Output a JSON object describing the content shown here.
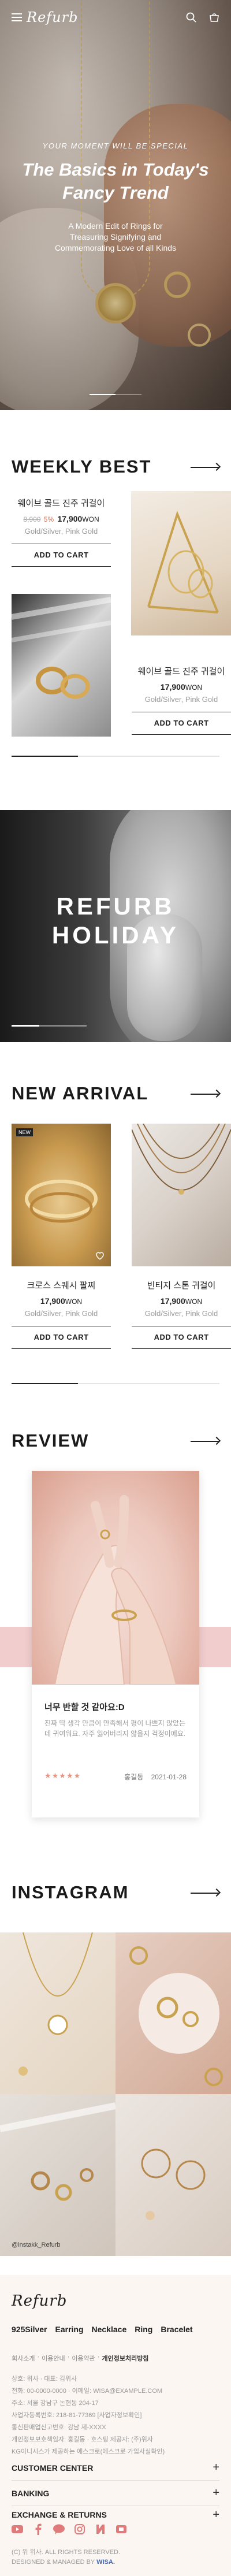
{
  "header": {
    "logo": "Refurb"
  },
  "hero": {
    "kicker": "YOUR MOMENT WILL BE SPECIAL",
    "title_line1": "The Basics in Today's",
    "title_line2": "Fancy Trend",
    "sub_line1": "A Modern Edit of Rings for",
    "sub_line2": "Treasuring Signifying and",
    "sub_line3": "Commemorating Love of all Kinds"
  },
  "weekly_best": {
    "title": "WEEKLY BEST",
    "products": [
      {
        "name": "웨이브 골드 진주 귀걸이",
        "old_price": "8,900",
        "discount": "5%",
        "price": "17,900",
        "unit": "WON",
        "colors": "Gold/Silver, Pink Gold",
        "cart": "ADD TO CART"
      },
      {
        "name": "웨이브 골드 진주 귀걸이",
        "price": "17,900",
        "unit": "WON",
        "colors": "Gold/Silver, Pink Gold",
        "cart": "ADD TO CART"
      }
    ]
  },
  "holiday": {
    "line1": "REFURB",
    "line2": "HOLIDAY"
  },
  "new_arrival": {
    "title": "NEW ARRIVAL",
    "products": [
      {
        "badge": "NEW",
        "name": "크로스 스퀘시 팔찌",
        "price": "17,900",
        "unit": "WON",
        "colors": "Gold/Silver, Pink Gold",
        "cart": "ADD TO CART"
      },
      {
        "name": "빈티지 스톤 귀걸이",
        "price": "17,900",
        "unit": "WON",
        "colors": "Gold/Silver, Pink Gold",
        "cart": "ADD TO CART"
      }
    ]
  },
  "review": {
    "title": "REVIEW",
    "card": {
      "headline": "너무 반할 것 같아요:D",
      "body": "진짜 딱 생각 만큼이 만족해서 평이 나쁘지 않았는데 귀여워요. 자주 잃어버리지 않을지 걱정이에요.",
      "stars": "★★★★★",
      "author": "홍길동",
      "date": "2021-01-28"
    }
  },
  "instagram": {
    "title": "INSTAGRAM",
    "handle": "@instakk_Refurb"
  },
  "footer": {
    "logo": "Refurb",
    "categories": [
      "925Silver",
      "Earring",
      "Necklace",
      "Ring",
      "Bracelet"
    ],
    "links": [
      "회사소개",
      "이용안내",
      "이용약관",
      "개인정보처리방침"
    ],
    "info": [
      "상호: 위사 · 대표: 김위사",
      "전화: 00-0000-0000 · 이메일: WISA@EXAMPLE.COM",
      "주소: 서울 강남구 논현동 204-17",
      "사업자등록번호: 218-81-77369 [사업자정보확인]",
      "통신판매업신고번호: 강남 제-XXXX",
      "개인정보보호책임자: 홍길동 · 호스팅 제공자: (주)위사",
      "KG이니시스가 제공하는 에스크로(에스크로 가입사실확인)"
    ],
    "accordions": [
      "CUSTOMER CENTER",
      "BANKING",
      "EXCHANGE & RETURNS"
    ],
    "copyright": "(C) 위 위사. ALL RIGHTS RESERVED.",
    "designed_prefix": "DESIGNED & MANAGED BY ",
    "designed_brand": "WISA."
  }
}
